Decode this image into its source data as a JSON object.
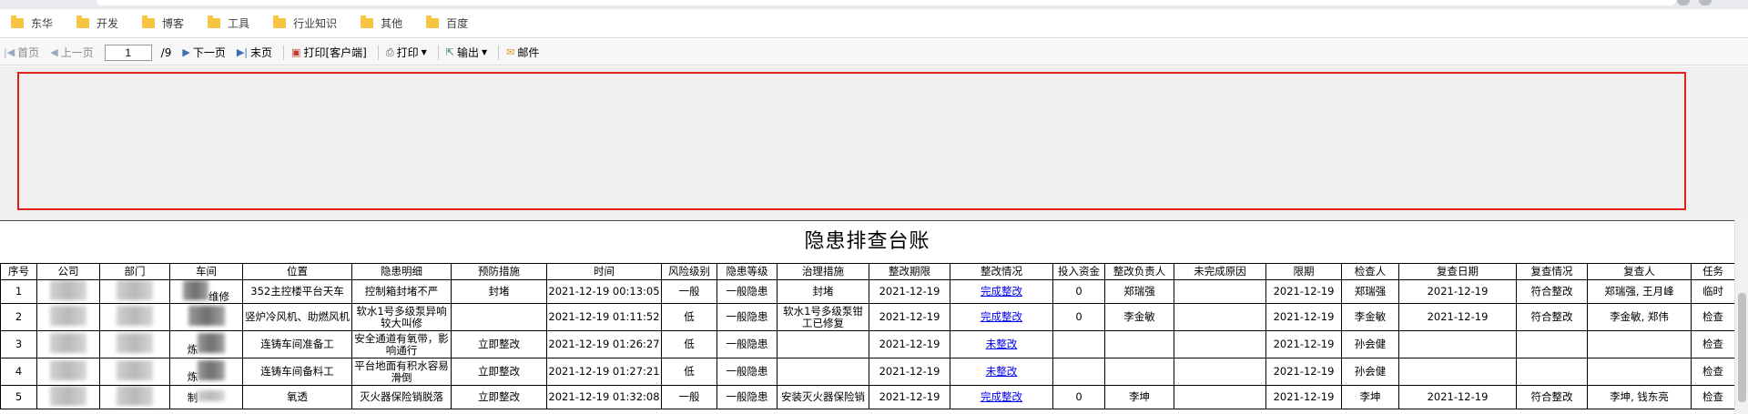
{
  "bookmarks": [
    "东华",
    "开发",
    "博客",
    "工具",
    "行业知识",
    "其他",
    "百度"
  ],
  "toolbar": {
    "first": "首页",
    "prev": "上一页",
    "page_value": "1",
    "page_total": "/9",
    "next": "下一页",
    "last": "末页",
    "print_client": "打印[客户端]",
    "print": "打印",
    "export": "输出",
    "mail": "邮件"
  },
  "report": {
    "title": "隐患排查台账",
    "columns": [
      "序号",
      "公司",
      "部门",
      "车间",
      "位置",
      "隐患明细",
      "预防措施",
      "时间",
      "风险级别",
      "隐患等级",
      "治理措施",
      "整改期限",
      "整改情况",
      "投入资金",
      "整改负责人",
      "未完成原因",
      "限期",
      "检查人",
      "复查日期",
      "复查情况",
      "复查人",
      "任务"
    ],
    "rows": [
      {
        "seq": "1",
        "dept_tail": "",
        "workshop": "维修",
        "location": "352主控楼平台天车",
        "detail": "控制箱封堵不严",
        "prevent": "封堵",
        "time": "2021-12-19 00:13:05",
        "risk": "一般",
        "level": "一般隐患",
        "measure": "封堵",
        "deadline": "2021-12-19",
        "status": "完成整改",
        "fund": "0",
        "owner": "郑瑞强",
        "reason": "",
        "limit": "2021-12-19",
        "inspector": "郑瑞强",
        "recheck_date": "2021-12-19",
        "recheck_status": "符合整改",
        "rechecker": "郑瑞强, 王月峰",
        "task": "临时"
      },
      {
        "seq": "2",
        "dept_tail": "",
        "workshop": "",
        "location": "竖炉冷风机、助燃风机",
        "detail": "软水1号多级泵异响较大叫修",
        "prevent": "",
        "time": "2021-12-19 01:11:52",
        "risk": "低",
        "level": "一般隐患",
        "measure": "软水1号多级泵钳工已修复",
        "deadline": "2021-12-19",
        "status": "完成整改",
        "fund": "0",
        "owner": "李金敏",
        "reason": "",
        "limit": "2021-12-19",
        "inspector": "李金敏",
        "recheck_date": "2021-12-19",
        "recheck_status": "符合整改",
        "rechecker": "李金敏, 郑伟",
        "task": "检查"
      },
      {
        "seq": "3",
        "dept_tail": "",
        "workshop": "炼",
        "location": "连铸车间准备工",
        "detail": "安全通道有氧带，影响通行",
        "prevent": "立即整改",
        "time": "2021-12-19 01:26:27",
        "risk": "低",
        "level": "一般隐患",
        "measure": "",
        "deadline": "2021-12-19",
        "status": "未整改",
        "fund": "",
        "owner": "",
        "reason": "",
        "limit": "2021-12-19",
        "inspector": "孙会健",
        "recheck_date": "",
        "recheck_status": "",
        "rechecker": "",
        "task": "检查"
      },
      {
        "seq": "4",
        "dept_tail": "",
        "workshop": "炼",
        "location": "连铸车间备料工",
        "detail": "平台地面有积水容易滑倒",
        "prevent": "立即整改",
        "time": "2021-12-19 01:27:21",
        "risk": "低",
        "level": "一般隐患",
        "measure": "",
        "deadline": "2021-12-19",
        "status": "未整改",
        "fund": "",
        "owner": "",
        "reason": "",
        "limit": "2021-12-19",
        "inspector": "孙会健",
        "recheck_date": "",
        "recheck_status": "",
        "rechecker": "",
        "task": "检查"
      },
      {
        "seq": "5",
        "dept_tail": "",
        "workshop": "制",
        "location": "氧透",
        "detail": "灭火器保险销脱落",
        "prevent": "立即整改",
        "time": "2021-12-19 01:32:08",
        "risk": "一般",
        "level": "一般隐患",
        "measure": "安装灭火器保险销",
        "deadline": "2021-12-19",
        "status": "完成整改",
        "fund": "0",
        "owner": "李坤",
        "reason": "",
        "limit": "2021-12-19",
        "inspector": "李坤",
        "recheck_date": "2021-12-19",
        "recheck_status": "符合整改",
        "rechecker": "李坤, 钱东亮",
        "task": "检查"
      }
    ]
  },
  "colors": {
    "frame_border": "#e0201b",
    "link": "#0000ee",
    "folder": "#f5c542"
  }
}
